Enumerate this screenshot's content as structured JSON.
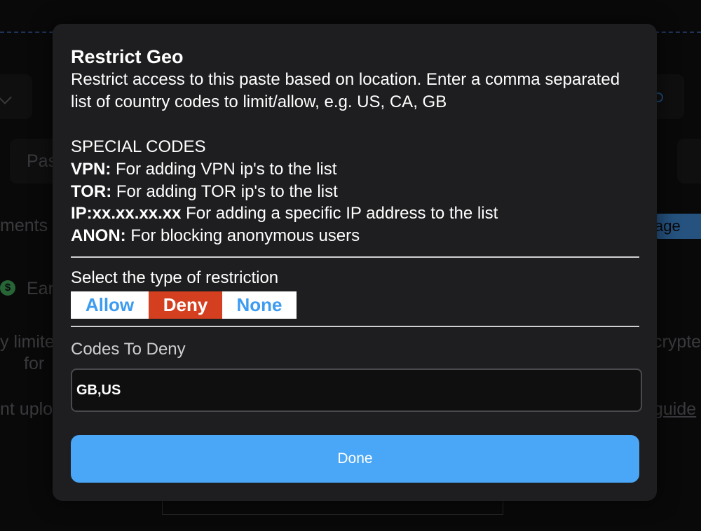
{
  "background": {
    "snippets": [
      "Pas",
      "ments",
      "Ear",
      "y limite",
      "for",
      "nt uplo",
      "crypte",
      "guide"
    ],
    "pill_label": "age",
    "dollar_glyph": "$"
  },
  "modal": {
    "title": "Restrict Geo",
    "description": "Restrict access to this paste based on location. Enter a comma separated list of country codes to limit/allow, e.g. US, CA, GB",
    "special_codes_heading": "SPECIAL CODES",
    "special_codes": [
      {
        "code": "VPN:",
        "text": " For adding VPN ip's to the list"
      },
      {
        "code": "TOR:",
        "text": " For adding TOR ip's to the list"
      },
      {
        "code": "IP:xx.xx.xx.xx",
        "text": " For adding a specific IP address to the list"
      },
      {
        "code": "ANON:",
        "text": " For blocking anonymous users"
      }
    ],
    "restriction_label": "Select the type of restriction",
    "restriction_options": [
      "Allow",
      "Deny",
      "None"
    ],
    "restriction_selected": "Deny",
    "codes_label": "Codes To Deny",
    "codes_value": "GB,US",
    "done_label": "Done"
  },
  "colors": {
    "accent": "#4aa6f6",
    "deny_active": "#d4401f",
    "option_text": "#3d9bf0",
    "modal_bg": "#1e1e20"
  }
}
